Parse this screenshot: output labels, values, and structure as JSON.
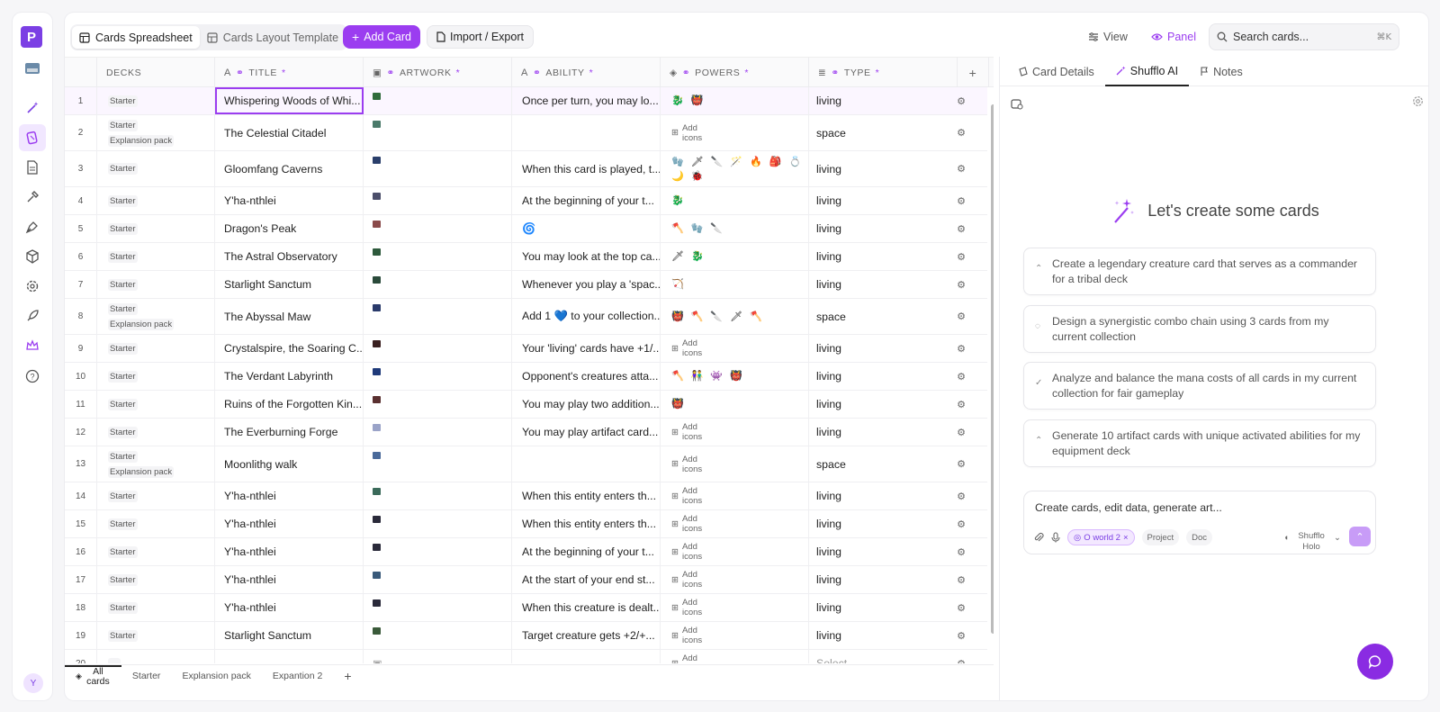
{
  "app": {
    "brand_colors": {
      "accent": "#9b3df0",
      "accent_dark": "#7b3fe4"
    }
  },
  "rail": {
    "items": [
      {
        "name": "logo-icon"
      },
      {
        "name": "workspace-thumbnail-icon"
      },
      {
        "name": "magic-wand-icon"
      },
      {
        "name": "cards-icon",
        "active": true
      },
      {
        "name": "document-icon"
      },
      {
        "name": "brush-icon"
      },
      {
        "name": "pen-tool-icon"
      },
      {
        "name": "package-icon"
      },
      {
        "name": "gear-icon"
      },
      {
        "name": "rocket-icon"
      },
      {
        "name": "crown-icon"
      },
      {
        "name": "help-icon"
      }
    ],
    "avatar_initial": "Y"
  },
  "toolbar": {
    "view_tabs": [
      {
        "label": "Cards Spreadsheet",
        "icon": "table-icon",
        "active": true
      },
      {
        "label": "Cards Layout Template",
        "icon": "layout-icon",
        "active": false
      }
    ],
    "add_card_label": "Add Card",
    "import_export_label": "Import / Export",
    "view_label": "View",
    "panel_label": "Panel",
    "search_placeholder": "Search cards...",
    "search_shortcut": "⌘K"
  },
  "columns": [
    {
      "label": "DECKS",
      "required": false
    },
    {
      "label": "TITLE",
      "required": true
    },
    {
      "label": "ARTWORK",
      "required": true
    },
    {
      "label": "ABILITY",
      "required": true
    },
    {
      "label": "POWERS",
      "required": true
    },
    {
      "label": "TYPE",
      "required": true
    }
  ],
  "add_icons_label": "Add icons",
  "rows": [
    {
      "n": "1",
      "decks": [
        "Starter"
      ],
      "title": "Whispering Woods of Whi...",
      "art": "#2f6b3a",
      "ability": "Once per turn, you may lo...",
      "powers": [
        "🐉",
        "👹"
      ],
      "type": "living"
    },
    {
      "n": "2",
      "decks": [
        "Starter",
        "Explansion pack"
      ],
      "title": "The Celestial Citadel",
      "art": "#4a7a6a",
      "ability": "",
      "powers": [],
      "type": "space"
    },
    {
      "n": "3",
      "decks": [
        "Starter"
      ],
      "title": "Gloomfang Caverns",
      "art": "#2a3f6b",
      "ability": "When this card is played, t...",
      "powers": [
        "🧤",
        "🗡",
        "🔪",
        "🪄",
        "🔥",
        "🎒",
        "💍",
        "🌙",
        "🐞"
      ],
      "type": "living"
    },
    {
      "n": "4",
      "decks": [
        "Starter"
      ],
      "title": "Y'ha-nthlei",
      "art": "#4b4e6a",
      "ability": "At the beginning of your t...",
      "powers": [
        "🐉"
      ],
      "type": "living"
    },
    {
      "n": "5",
      "decks": [
        "Starter"
      ],
      "title": "Dragon's Peak",
      "art": "#8a4a4a",
      "ability": "🌀",
      "powers": [
        "🪓",
        "🧤",
        "🔪"
      ],
      "type": "living"
    },
    {
      "n": "6",
      "decks": [
        "Starter"
      ],
      "title": "The Astral Observatory",
      "art": "#2d5a3c",
      "ability": "You may look at the top ca...",
      "powers": [
        "🗡",
        "🐉"
      ],
      "type": "living"
    },
    {
      "n": "7",
      "decks": [
        "Starter"
      ],
      "title": "Starlight Sanctum",
      "art": "#2a4a3a",
      "ability": "Whenever you play a 'spac...",
      "powers": [
        "🏹"
      ],
      "type": "living"
    },
    {
      "n": "8",
      "decks": [
        "Starter",
        "Explansion pack"
      ],
      "title": "The Abyssal Maw",
      "art": "#2a3a6b",
      "ability": "Add 1 💙 to your collection...",
      "powers": [
        "👹",
        "🪓",
        "🔪",
        "🗡",
        "🪓"
      ],
      "type": "space"
    },
    {
      "n": "9",
      "decks": [
        "Starter"
      ],
      "title": "Crystalspire, the Soaring C...",
      "art": "#3a2020",
      "ability": "Your 'living' cards have +1/...",
      "powers": [],
      "type": "living"
    },
    {
      "n": "10",
      "decks": [
        "Starter"
      ],
      "title": "The Verdant Labyrinth",
      "art": "#1f3a7a",
      "ability": "Opponent's creatures atta...",
      "powers": [
        "🪓",
        "👫",
        "👾",
        "👹"
      ],
      "type": "living"
    },
    {
      "n": "11",
      "decks": [
        "Starter"
      ],
      "title": "Ruins of the Forgotten Kin...",
      "art": "#5a3030",
      "ability": "You may play two addition...",
      "powers": [
        "👹"
      ],
      "type": "living"
    },
    {
      "n": "12",
      "decks": [
        "Starter"
      ],
      "title": "The Everburning Forge",
      "art": "#9aa3c8",
      "ability": "You may play artifact card...",
      "powers": [],
      "type": "living"
    },
    {
      "n": "13",
      "decks": [
        "Starter",
        "Explansion pack"
      ],
      "title": "Moonlithg walk",
      "art": "#4a6a9a",
      "ability": "",
      "powers": [],
      "type": "space"
    },
    {
      "n": "14",
      "decks": [
        "Starter"
      ],
      "title": "Y'ha-nthlei",
      "art": "#3a6a5a",
      "ability": "When this entity enters th...",
      "powers": [],
      "type": "living"
    },
    {
      "n": "15",
      "decks": [
        "Starter"
      ],
      "title": "Y'ha-nthlei",
      "art": "#2a2a3a",
      "ability": "When this entity enters th...",
      "powers": [],
      "type": "living"
    },
    {
      "n": "16",
      "decks": [
        "Starter"
      ],
      "title": "Y'ha-nthlei",
      "art": "#2a2a3a",
      "ability": "At the beginning of your t...",
      "powers": [],
      "type": "living"
    },
    {
      "n": "17",
      "decks": [
        "Starter"
      ],
      "title": "Y'ha-nthlei",
      "art": "#3a5a7a",
      "ability": "At the start of your end st...",
      "powers": [],
      "type": "living"
    },
    {
      "n": "18",
      "decks": [
        "Starter"
      ],
      "title": "Y'ha-nthlei",
      "art": "#2a2a3a",
      "ability": "When this creature is dealt...",
      "powers": [],
      "type": "living"
    },
    {
      "n": "19",
      "decks": [
        "Starter"
      ],
      "title": "Starlight Sanctum",
      "art": "#3a5a3a",
      "ability": "Target creature gets +2/+...",
      "powers": [],
      "type": "living"
    },
    {
      "n": "20",
      "decks": [
        "—"
      ],
      "title": "",
      "art": "",
      "ability": "",
      "powers": [],
      "type": "Select...",
      "placeholder": true
    }
  ],
  "bottom_tabs": [
    {
      "label": "All cards",
      "active": true
    },
    {
      "label": "Starter"
    },
    {
      "label": "Explansion pack"
    },
    {
      "label": "Expantion 2"
    }
  ],
  "panel": {
    "tabs": [
      {
        "label": "Card Details",
        "icon": "card-icon"
      },
      {
        "label": "Shufflo AI",
        "icon": "magic-wand-icon",
        "active": true
      },
      {
        "label": "Notes",
        "icon": "flag-icon"
      }
    ],
    "hero_text": "Let's create some cards",
    "suggestions": [
      {
        "text": "Create a legendary creature card that serves as a commander for a tribal deck",
        "icon": "chevron-up-icon"
      },
      {
        "text": "Design a synergistic combo chain using 3 cards from my current collection",
        "icon": "bulb-icon"
      },
      {
        "text": "Analyze and balance the mana costs of all cards in my current collection for fair gameplay",
        "icon": "check-icon"
      },
      {
        "text": "Generate 10 artifact cards with unique activated abilities for my equipment deck",
        "icon": "chevron-up-icon"
      }
    ],
    "composer": {
      "placeholder": "Create cards, edit data, generate art...",
      "context_chip": "O world 2",
      "chips": [
        "Project",
        "Doc"
      ],
      "model": "Shufflo Holo"
    }
  }
}
